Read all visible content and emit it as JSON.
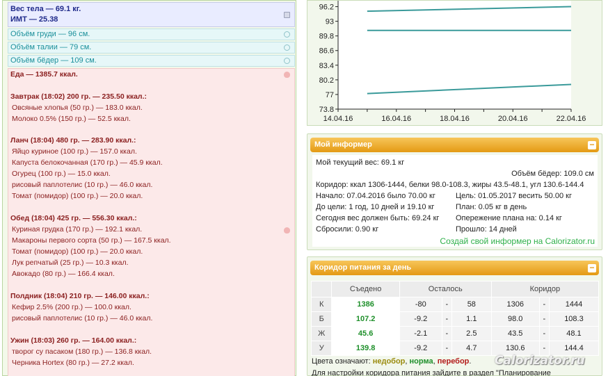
{
  "diary": {
    "weight": {
      "line1": "Вес тела — 69.1 кг.",
      "line2": "ИМТ — 25.38"
    },
    "measurements": {
      "chest": "Объём груди — 96 см.",
      "waist": "Объём талии — 79 см.",
      "hips": "Объём бёдер — 109 см."
    },
    "food_total": "Еда — 1385.7 ккал.",
    "meals": [
      {
        "title": "Завтрак (18:02) 200 гр. — 235.50 ккал.:",
        "items": [
          "Овсяные хлопья (50 гр.) — 183.0 ккал.",
          "Молоко 0.5% (150 гр.) — 52.5 ккал."
        ]
      },
      {
        "title": "Ланч (18:04) 480 гр. — 283.90 ккал.:",
        "items": [
          "Яйцо куриное (100 гр.) — 157.0 ккал.",
          "Капуста белокочанная (170 гр.) — 45.9 ккал.",
          "Огурец (100 гр.) — 15.0 ккал.",
          "рисовый паплотелис (10 гр.) — 46.0 ккал.",
          "Томат (помидор) (100 гр.) — 20.0 ккал."
        ]
      },
      {
        "title": "Обед (18:04) 425 гр. — 556.30 ккал.:",
        "items": [
          "Куриная грудка (170 гр.) — 192.1 ккал.",
          "Макароны первого сорта (50 гр.) — 167.5 ккал.",
          "Томат (помидор) (100 гр.) — 20.0 ккал.",
          "Лук репчатый (25 гр.) — 10.3 ккал.",
          "Авокадо (80 гр.) — 166.4 ккал."
        ]
      },
      {
        "title": "Полдник (18:04) 210 гр. — 146.00 ккал.:",
        "items": [
          "Кефир 2.5% (200 гр.) — 100.0 ккал.",
          "рисовый паплотелис (10 гр.) — 46.0 ккал."
        ]
      },
      {
        "title": "Ужин (18:03) 260 гр. — 164.00 ккал.:",
        "items": [
          "творог су пасаком (180 гр.) — 136.8 ккал.",
          "Черника Hortex (80 гр.) — 27.2 ккал."
        ]
      }
    ]
  },
  "chart_data": {
    "type": "line",
    "y_ticks": [
      "96.2",
      "93",
      "89.8",
      "86.6",
      "83.4",
      "80.2",
      "77",
      "73.8"
    ],
    "x_ticks": [
      "14.04.16",
      "16.04.16",
      "18.04.16",
      "20.04.16",
      "22.04.16"
    ],
    "ylim": [
      73.8,
      97.5
    ],
    "x_dates": [
      "14.04.16",
      "15.04.16",
      "16.04.16",
      "17.04.16",
      "18.04.16",
      "19.04.16",
      "20.04.16",
      "21.04.16",
      "22.04.16"
    ],
    "series": [
      {
        "x": [
          "15.04.16",
          "22.04.16"
        ],
        "values": [
          95.2,
          96.2
        ]
      },
      {
        "x": [
          "15.04.16",
          "22.04.16"
        ],
        "values": [
          91.0,
          91.0
        ]
      },
      {
        "x": [
          "15.04.16",
          "22.04.16"
        ],
        "values": [
          77.2,
          79.2
        ]
      }
    ],
    "grid": false,
    "line_color": "#3a9a9a"
  },
  "informer": {
    "title": "Мой информер",
    "collapse": "−",
    "lines": {
      "current_weight": "Мой текущий вес: 69.1 кг",
      "hips": "Объём бёдер: 109.0 см",
      "corridor": "Коридор: ккал 1306-1444, белки 98.0-108.3, жиры 43.5-48.1, угл 130.6-144.4",
      "start": "Начало: 07.04.2016 было 70.00 кг",
      "goal": "Цель: 01.05.2017 весить 50.00 кг",
      "to_goal": "До цели: 1 год, 10 дней и 19.10 кг",
      "plan": "План: 0.05 кг в день",
      "today_should": "Сегодня вес должен быть: 69.24 кг",
      "ahead": "Опережение плана на: 0.14 кг",
      "lost": "Сбросили: 0.90 кг",
      "passed": "Прошло: 14 дней"
    },
    "link": "Создай свой информер на Calorizator.ru"
  },
  "corridor": {
    "title": "Коридор питания за день",
    "collapse": "−",
    "headers": [
      "",
      "Съедено",
      "Осталось",
      "Коридор"
    ],
    "rows": [
      {
        "label": "К",
        "eaten": "1386",
        "left_a": "-80",
        "left_b": "58",
        "cor_a": "1306",
        "cor_b": "1444"
      },
      {
        "label": "Б",
        "eaten": "107.2",
        "left_a": "-9.2",
        "left_b": "1.1",
        "cor_a": "98.0",
        "cor_b": "108.3"
      },
      {
        "label": "Ж",
        "eaten": "45.6",
        "left_a": "-2.1",
        "left_b": "2.5",
        "cor_a": "43.5",
        "cor_b": "48.1"
      },
      {
        "label": "У",
        "eaten": "139.8",
        "left_a": "-9.2",
        "left_b": "4.7",
        "cor_a": "130.6",
        "cor_b": "144.4"
      }
    ],
    "dash": "-",
    "legend": {
      "prefix": "Цвета означают:",
      "under": "недобор",
      "sep1": ",",
      "norm": "норма",
      "sep2": ",",
      "over": "перебор",
      "end": "."
    },
    "note": "Для настройки коридора питания зайдите в раздел \"Планирование"
  },
  "watermark": "Calorizator.ru"
}
